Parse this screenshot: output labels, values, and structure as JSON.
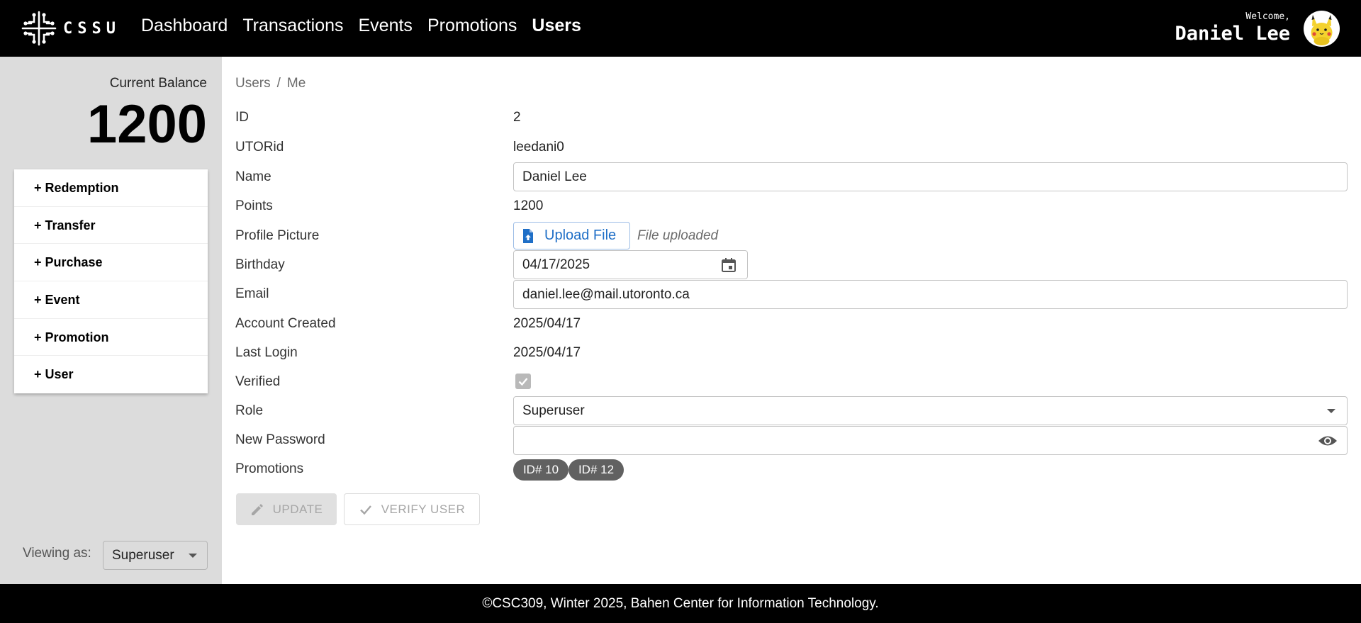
{
  "header": {
    "logo_text": "CSSU",
    "nav": [
      {
        "label": "Dashboard",
        "active": false
      },
      {
        "label": "Transactions",
        "active": false
      },
      {
        "label": "Events",
        "active": false
      },
      {
        "label": "Promotions",
        "active": false
      },
      {
        "label": "Users",
        "active": true
      }
    ],
    "welcome_label": "Welcome,",
    "user_name": "Daniel Lee",
    "avatar_icon": "pikachu-avatar"
  },
  "sidebar": {
    "balance_label": "Current Balance",
    "balance_value": "1200",
    "actions": [
      "+ Redemption",
      "+ Transfer",
      "+ Purchase",
      "+ Event",
      "+ Promotion",
      "+ User"
    ],
    "viewing_as_label": "Viewing as:",
    "viewing_as_value": "Superuser"
  },
  "breadcrumb": {
    "parent": "Users",
    "separator": "/",
    "current": "Me"
  },
  "profile": {
    "labels": {
      "id": "ID",
      "utorid": "UTORid",
      "name": "Name",
      "points": "Points",
      "profile_picture": "Profile Picture",
      "birthday": "Birthday",
      "email": "Email",
      "account_created": "Account Created",
      "last_login": "Last Login",
      "verified": "Verified",
      "role": "Role",
      "new_password": "New Password",
      "promotions": "Promotions"
    },
    "values": {
      "id": "2",
      "utorid": "leedani0",
      "name": "Daniel Lee",
      "points": "1200",
      "upload_button": "Upload File",
      "file_status": "File uploaded",
      "birthday": "04/17/2025",
      "email": "daniel.lee@mail.utoronto.ca",
      "account_created": "2025/04/17",
      "last_login": "2025/04/17",
      "verified": true,
      "role": "Superuser",
      "new_password": "",
      "promotions": [
        "ID# 10",
        "ID# 12"
      ]
    }
  },
  "buttons": {
    "update": "UPDATE",
    "verify": "VERIFY USER"
  },
  "footer": {
    "text": "©CSC309, Winter 2025, Bahen Center for Information Technology."
  },
  "colors": {
    "topbar": "#000000",
    "sidebar": "#dcdcdc",
    "accent": "#1f6fc7",
    "chip": "#616161"
  }
}
